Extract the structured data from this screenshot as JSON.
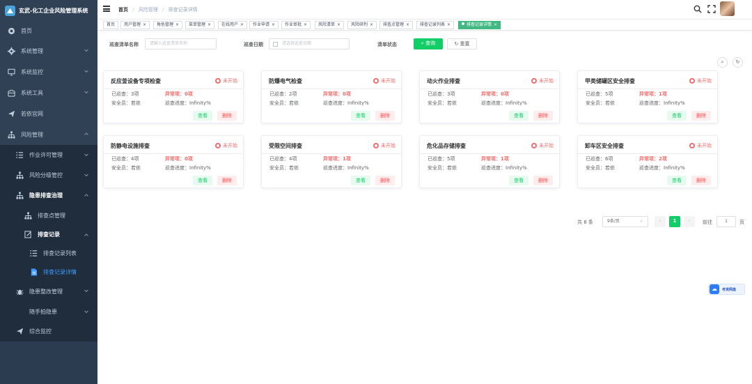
{
  "app": {
    "title": "玄武-化工企业风险管理系统"
  },
  "sidebar": {
    "items": [
      {
        "label": "首页"
      },
      {
        "label": "系统管理"
      },
      {
        "label": "系统监控"
      },
      {
        "label": "系统工具"
      },
      {
        "label": "若依官网"
      },
      {
        "label": "风险管理"
      },
      {
        "label": "作业许可管理"
      },
      {
        "label": "风险分级管控"
      },
      {
        "label": "隐患排查治理"
      },
      {
        "label": "排查点管理"
      },
      {
        "label": "排查记录"
      },
      {
        "label": "排查记录列表"
      },
      {
        "label": "排查记录详情"
      },
      {
        "label": "隐患整改管理"
      },
      {
        "label": "随手拍隐患"
      },
      {
        "label": "综合监控"
      }
    ]
  },
  "breadcrumb": [
    "首页",
    "风险管理",
    "排查记录详情"
  ],
  "tabs": [
    {
      "label": "首页"
    },
    {
      "label": "用户管理"
    },
    {
      "label": "角色管理"
    },
    {
      "label": "菜单管理"
    },
    {
      "label": "在线用户"
    },
    {
      "label": "作业申请"
    },
    {
      "label": "作业审批"
    },
    {
      "label": "风险清单"
    },
    {
      "label": "风险研判"
    },
    {
      "label": "排查点管理"
    },
    {
      "label": "排查记录列表"
    },
    {
      "label": "排查记录详情"
    }
  ],
  "tab_close": "×",
  "search": {
    "name_label": "巡查清单名称",
    "name_placeholder": "请输入巡查清单名称",
    "date_label": "巡查日期",
    "date_placeholder": "请选择巡查日期",
    "status_label": "清单状态",
    "query": "查询",
    "reset": "重置"
  },
  "card_labels": {
    "checked": "已巡查：",
    "abnormal": "异常项：",
    "safety": "安全员：",
    "progress": "巡查进度：",
    "view": "查看",
    "delete": "删除"
  },
  "cards": [
    {
      "title": "反应釜设备专项检查",
      "status": "未开始",
      "checked": "3项",
      "abnormal": "0项",
      "officer": "若依",
      "progress": "Infinity%"
    },
    {
      "title": "防爆电气检查",
      "status": "未开始",
      "checked": "2项",
      "abnormal": "0项",
      "officer": "若依",
      "progress": "Infinity%"
    },
    {
      "title": "动火作业排查",
      "status": "未开始",
      "checked": "3项",
      "abnormal": "0项",
      "officer": "若依",
      "progress": "Infinity%"
    },
    {
      "title": "甲类储罐区安全排查",
      "status": "未开始",
      "checked": "5项",
      "abnormal": "1项",
      "officer": "若依",
      "progress": "Infinity%"
    },
    {
      "title": "防静电设施排查",
      "status": "未开始",
      "checked": "4项",
      "abnormal": "0项",
      "officer": "若依",
      "progress": "Infinity%"
    },
    {
      "title": "受限空间排查",
      "status": "未开始",
      "checked": "4项",
      "abnormal": "1项",
      "officer": "若依",
      "progress": "Infinity%"
    },
    {
      "title": "危化品存储排查",
      "status": "未开始",
      "checked": "5项",
      "abnormal": "1项",
      "officer": "若依",
      "progress": "Infinity%"
    },
    {
      "title": "卸车区安全排查",
      "status": "未开始",
      "checked": "6项",
      "abnormal": "2项",
      "officer": "若依",
      "progress": "Infinity%"
    }
  ],
  "pagination": {
    "total": "共 8 条",
    "page_size": "9条/页",
    "current": "1",
    "goto": "前往",
    "goto_value": "1",
    "page_unit": "页"
  },
  "cloud": {
    "label": "考资网盘"
  }
}
